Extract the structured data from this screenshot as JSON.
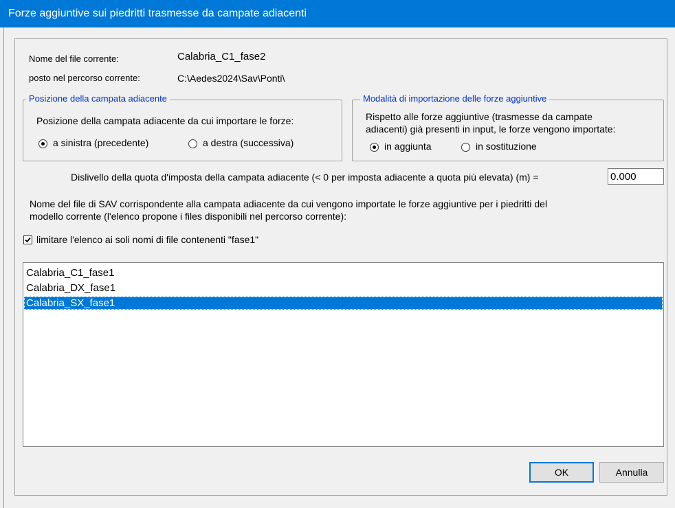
{
  "window": {
    "title": "Forze aggiuntive sui piedritti trasmesse da campate adiacenti"
  },
  "file_info": {
    "name_label": "Nome del file corrente:",
    "name_value": "Calabria_C1_fase2",
    "path_label": "posto nel percorso corrente:",
    "path_value": "C:\\Aedes2024\\Sav\\Ponti\\"
  },
  "position_group": {
    "legend": "Posizione della campata adiacente",
    "description": "Posizione della campata adiacente da cui importare le forze:",
    "options": [
      {
        "label": "a sinistra (precedente)",
        "selected": true
      },
      {
        "label": "a destra (successiva)",
        "selected": false
      }
    ]
  },
  "import_group": {
    "legend": "Modalità di importazione delle forze aggiuntive",
    "description_line1": "Rispetto alle forze aggiuntive (trasmesse da campate",
    "description_line2": "adiacenti) già presenti in input, le forze vengono importate:",
    "options": [
      {
        "label": "in aggiunta",
        "selected": true
      },
      {
        "label": "in sostituzione",
        "selected": false
      }
    ]
  },
  "dislivello": {
    "label": "Dislivello della quota d'imposta della campata adiacente (< 0 per imposta adiacente a quota più elevata) (m) =",
    "value": "0.000"
  },
  "sav_file": {
    "description_line1": "Nome del file di SAV corrispondente alla campata adiacente da cui vengono importate le forze aggiuntive per i piedritti del",
    "description_line2": "modello corrente (l'elenco propone i files disponibili nel percorso corrente):",
    "filter_label": "limitare l'elenco ai soli nomi di file contenenti \"fase1\"",
    "filter_checked": true,
    "items": [
      "Calabria_C1_fase1",
      "Calabria_DX_fase1",
      "Calabria_SX_fase1"
    ],
    "selected_index": 2
  },
  "buttons": {
    "ok": "OK",
    "cancel": "Annulla"
  },
  "colors": {
    "titlebar": "#0078d7",
    "legend_text": "#0033cc",
    "selection": "#0078d7"
  }
}
